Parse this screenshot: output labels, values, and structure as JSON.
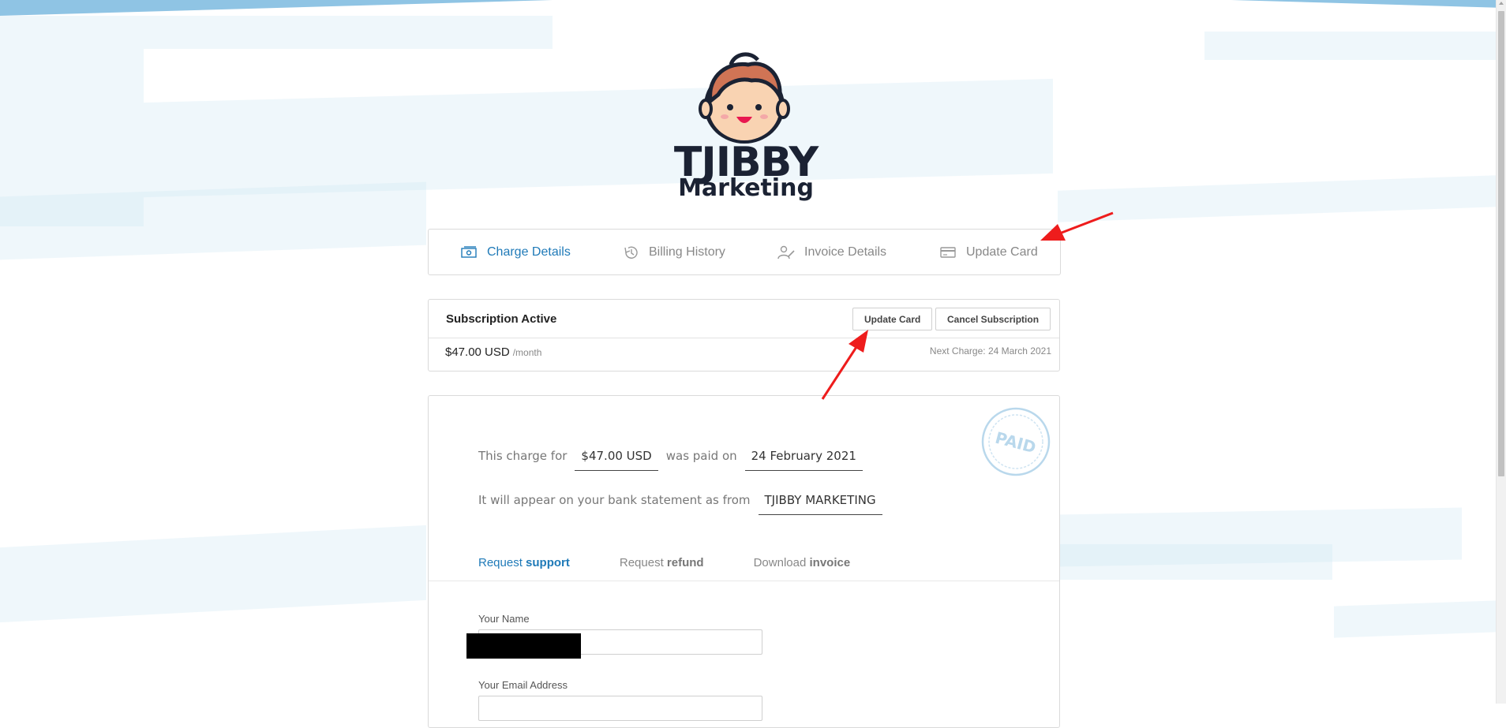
{
  "brand": {
    "name": "TJIBBY",
    "subtitle": "Marketing",
    "colors": {
      "accent": "#1f7ab8",
      "dark": "#1b2233",
      "stripe": "#d2e8f4"
    }
  },
  "tabs": [
    {
      "label": "Charge Details",
      "icon": "money-icon",
      "active": true
    },
    {
      "label": "Billing History",
      "icon": "history-icon",
      "active": false
    },
    {
      "label": "Invoice Details",
      "icon": "user-edit-icon",
      "active": false
    },
    {
      "label": "Update Card",
      "icon": "credit-card-icon",
      "active": false
    }
  ],
  "subscription": {
    "title": "Subscription Active",
    "update_label": "Update Card",
    "cancel_label": "Cancel Subscription",
    "price": "$47.00 USD",
    "period": "/month",
    "next_charge": "Next Charge: 24 March 2021"
  },
  "charge": {
    "prefix": "This charge for",
    "amount": "$47.00 USD",
    "middle": "was paid on",
    "date": "24 February 2021",
    "statement_prefix": "It will appear on your bank statement as from",
    "statement_name": "TJIBBY MARKETING",
    "stamp_text": "PAID"
  },
  "actions": [
    {
      "prefix": "Request ",
      "bold": "support",
      "active": true
    },
    {
      "prefix": "Request ",
      "bold": "refund",
      "active": false
    },
    {
      "prefix": "Download ",
      "bold": "invoice",
      "active": false
    }
  ],
  "form": {
    "name_label": "Your Name",
    "email_label": "Your Email Address"
  }
}
